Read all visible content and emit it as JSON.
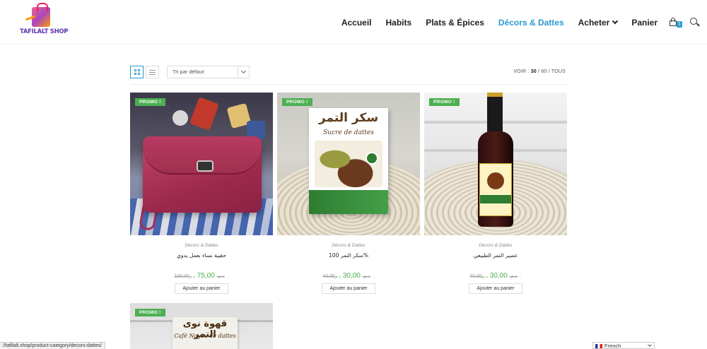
{
  "logo": {
    "text": "TAFILALT SHOP"
  },
  "nav": {
    "items": [
      {
        "label": "Accueil"
      },
      {
        "label": "Habits"
      },
      {
        "label": "Plats & Épices"
      },
      {
        "label": "Décors & Dattes"
      },
      {
        "label": "Acheter"
      },
      {
        "label": "Panier"
      }
    ],
    "active": "Décors & Dattes",
    "cart_count": "1",
    "accent_color": "#2a9bd1"
  },
  "toolbar": {
    "sort_selected": "Tri par défaut",
    "view_label": "VOIR :",
    "view_options": [
      "30",
      "60",
      "TOUS"
    ],
    "separator": "/"
  },
  "products": [
    {
      "badge": "PROMO !",
      "category": "Décors & Dattes",
      "title": "حقيبة نساء بعمل يدوي",
      "old_price": "100,00",
      "old_currency": "د.م.",
      "new_price": "75,00",
      "currency": "د.م.",
      "button": "Ajouter au panier"
    },
    {
      "badge": "PROMO !",
      "category": "Décors & Dattes",
      "title": "سكر التمر 100%",
      "old_price": "40,00",
      "old_currency": "د.م.",
      "new_price": "30,00",
      "currency": "د.م.",
      "button": "Ajouter au panier",
      "image_text": {
        "arabic": "سكر التمر",
        "french": "Sucre de dattes"
      }
    },
    {
      "badge": "PROMO !",
      "category": "Décors & Dattes",
      "title": "عصير التمر الطبيعي",
      "old_price": "40,00",
      "old_currency": "د.م.",
      "new_price": "30,00",
      "currency": "د.م.",
      "button": "Ajouter au panier"
    },
    {
      "badge": "PROMO !",
      "image_text": {
        "arabic": "قهوة نوى التمر",
        "french": "Café Noyau de dattes"
      }
    }
  ],
  "status_url": "//tafilalt.shop/product-category/decors-dattes/",
  "language": {
    "selected": "French"
  },
  "colors": {
    "promo": "#4caf50",
    "price": "#4caf50",
    "accent": "#2a9bd1"
  }
}
